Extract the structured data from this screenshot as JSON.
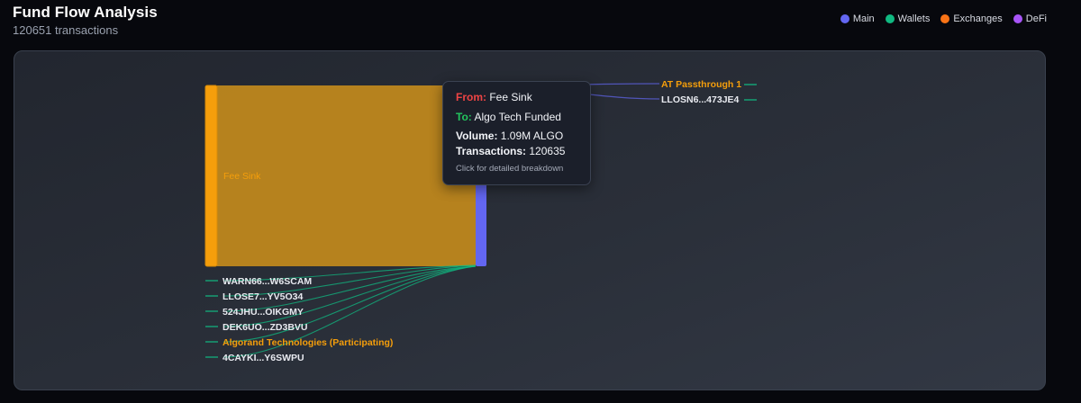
{
  "header": {
    "title": "Fund Flow Analysis",
    "subtitle": "120651 transactions"
  },
  "legend": [
    {
      "label": "Main",
      "color": "#6366f1"
    },
    {
      "label": "Wallets",
      "color": "#10b981"
    },
    {
      "label": "Exchanges",
      "color": "#f97316"
    },
    {
      "label": "DeFi",
      "color": "#a855f7"
    }
  ],
  "colors": {
    "fee_sink": "#f59e0b",
    "main": "#6366f1",
    "wallet_link": "#10b981",
    "exchange_text": "#f59e0b"
  },
  "nodes": {
    "source": "Fee Sink",
    "right_targets": [
      "AT Passthrough 1",
      "LLOSN6...473JE4"
    ],
    "wallets": [
      {
        "label": "WARN66...W6SCAM",
        "highlight": false
      },
      {
        "label": "LLOSE7...YV5O34",
        "highlight": false
      },
      {
        "label": "524JHU...OIKGMY",
        "highlight": false
      },
      {
        "label": "DEK6UO...ZD3BVU",
        "highlight": false
      },
      {
        "label": "Algorand Technologies (Participating)",
        "highlight": true
      },
      {
        "label": "4CAYKI...Y6SWPU",
        "highlight": false
      }
    ]
  },
  "tooltip": {
    "from_key": "From:",
    "from_value": "Fee Sink",
    "to_key": "To:",
    "to_value": "Algo Tech Funded",
    "volume_key": "Volume:",
    "volume_value": "1.09M ALGO",
    "tx_key": "Transactions:",
    "tx_value": "120635",
    "hint": "Click for detailed breakdown"
  }
}
